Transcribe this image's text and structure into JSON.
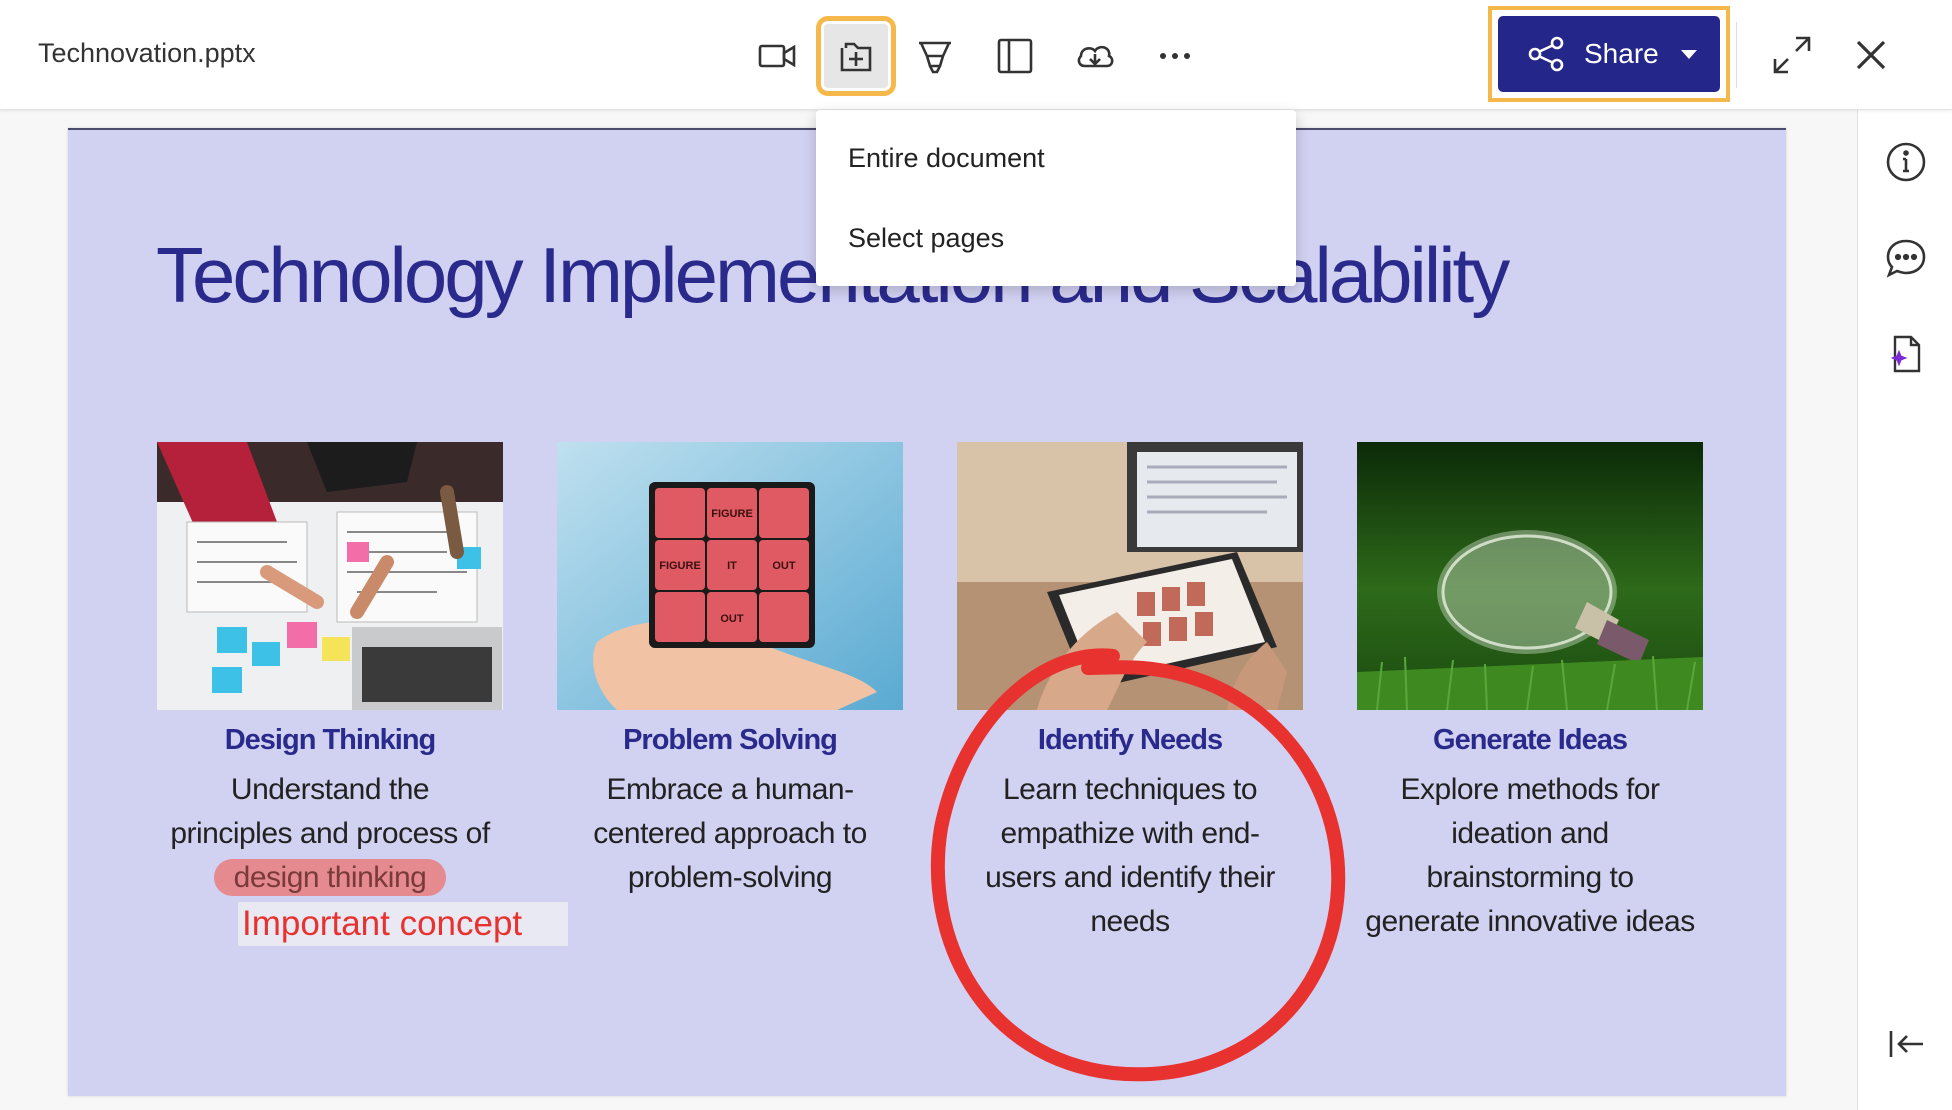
{
  "file_name": "Technovation.pptx",
  "toolbar": {
    "share_label": "Share",
    "accent_color": "#24268a",
    "highlight_color": "#f5b84a"
  },
  "dropdown": {
    "items": [
      "Entire document",
      "Select pages"
    ]
  },
  "slide": {
    "title": "Technology Implementation and Scalability",
    "background": "#d1d1f1",
    "cards": [
      {
        "heading": "Design Thinking",
        "body_lines": [
          "Understand the",
          "principles and process of"
        ],
        "highlight": "design thinking"
      },
      {
        "heading": "Problem Solving",
        "body_lines": [
          "Embrace a human-",
          "centered approach to",
          "problem-solving"
        ]
      },
      {
        "heading": "Identify Needs",
        "body_lines": [
          "Learn techniques to",
          "empathize with end-",
          "users and identify their",
          "needs"
        ]
      },
      {
        "heading": "Generate Ideas",
        "body_lines": [
          "Explore methods for",
          "ideation and",
          "brainstorming to",
          "generate innovative ideas"
        ]
      }
    ],
    "cube_labels": [
      "FIGURE",
      "FIGURE",
      "IT",
      "OUT",
      "OUT"
    ],
    "note_text": "Important concept",
    "annotation_color": "#e8322f"
  }
}
